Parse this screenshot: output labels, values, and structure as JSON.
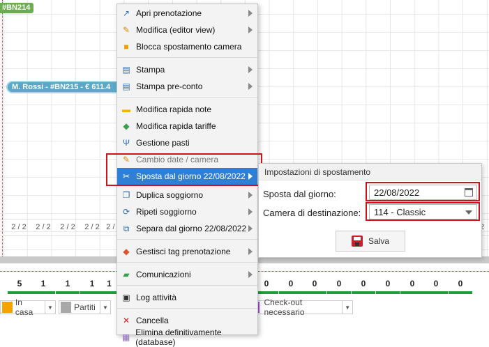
{
  "planner": {
    "booking_top_label": "#BN214",
    "booking_rossi_label": "M. Rossi - #BN215 - € 611.4",
    "occupancy_cells": [
      "2 / 2",
      "2 / 2",
      "2 / 2",
      "2 / 2",
      "2 / 2",
      "/ 2"
    ],
    "count_cells": [
      "5",
      "1",
      "1",
      "1",
      "1",
      "0",
      "0",
      "0",
      "0",
      "0",
      "0",
      "0",
      "0",
      "0"
    ],
    "legend": [
      {
        "label": "In casa",
        "color": "#f4a300"
      },
      {
        "label": "Partiti",
        "color": "#a8a8a8"
      },
      {
        "label": "Check-out necessario",
        "color": "#a64ad8"
      }
    ]
  },
  "context_menu": {
    "items": [
      {
        "label": "Apri prenotazione",
        "icon": "open-booking-icon",
        "glyph": "↗",
        "color": "#2f6fb3",
        "submenu": true
      },
      {
        "label": "Modifica (editor view)",
        "icon": "pencil-icon",
        "glyph": "✎",
        "color": "#e08a00",
        "submenu": true
      },
      {
        "label": "Blocca spostamento camera",
        "icon": "lock-icon",
        "glyph": "🔒",
        "color": "#e8a000",
        "submenu": false
      },
      {
        "label": "Stampa",
        "icon": "printer-icon",
        "glyph": "🖶",
        "color": "#3a6fa8",
        "submenu": true
      },
      {
        "label": "Stampa pre-conto",
        "icon": "printer-icon",
        "glyph": "🖶",
        "color": "#3a6fa8",
        "submenu": true
      },
      {
        "label": "Modifica rapida note",
        "icon": "note-icon",
        "glyph": "▬",
        "color": "#f2b600",
        "submenu": false
      },
      {
        "label": "Modifica rapida tariffe",
        "icon": "tag-icon",
        "glyph": "◆",
        "color": "#3aa04a",
        "submenu": false
      },
      {
        "label": "Gestione pasti",
        "icon": "cutlery-icon",
        "glyph": "✄",
        "color": "#2f6fb3",
        "submenu": false
      },
      {
        "label": "Cambio date / camera",
        "icon": "pencil-icon",
        "glyph": "✎",
        "color": "#e08a00",
        "submenu": false
      },
      {
        "label": "Sposta dal giorno 22/08/2022",
        "icon": "scissors-icon",
        "glyph": "✂",
        "color": "#ffffff",
        "submenu": true
      },
      {
        "label": "Duplica soggiorno",
        "icon": "duplicate-icon",
        "glyph": "❐",
        "color": "#2f6fb3",
        "submenu": true
      },
      {
        "label": "Ripeti soggiorno",
        "icon": "repeat-icon",
        "glyph": "⟳",
        "color": "#2f6fb3",
        "submenu": true
      },
      {
        "label": "Separa dal giorno 22/08/2022",
        "icon": "split-icon",
        "glyph": "⧉",
        "color": "#2f6fb3",
        "submenu": true
      },
      {
        "label": "Gestisci tag prenotazione",
        "icon": "tag-icon",
        "glyph": "◆",
        "color": "#e0522a",
        "submenu": true
      },
      {
        "label": "Comunicazioni",
        "icon": "chat-icon",
        "glyph": "▰",
        "color": "#3aa04a",
        "submenu": true
      },
      {
        "label": "Log attività",
        "icon": "terminal-icon",
        "glyph": "▣",
        "color": "#333333",
        "submenu": false
      },
      {
        "label": "Cancella",
        "icon": "close-icon",
        "glyph": "✕",
        "color": "#d22",
        "submenu": false
      },
      {
        "label": "Elimina definitivamente (database)",
        "icon": "database-delete-icon",
        "glyph": "▦",
        "color": "#8c6bb8",
        "submenu": false
      }
    ]
  },
  "submenu": {
    "title": "Impostazioni di spostamento",
    "from_label": "Sposta dal giorno:",
    "from_value": "22/08/2022",
    "room_label": "Camera di destinazione:",
    "room_value": "114 - Classic",
    "save_label": "Salva"
  }
}
